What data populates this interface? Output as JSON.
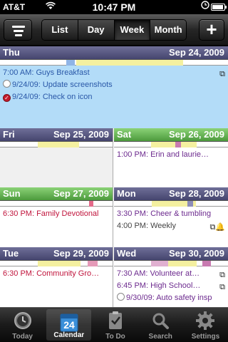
{
  "status": {
    "carrier": "AT&T",
    "time": "10:47 PM"
  },
  "nav": {
    "segments": [
      "List",
      "Day",
      "Week",
      "Month"
    ],
    "selected": "Week",
    "add": "+"
  },
  "days": [
    {
      "weekday": "Thu",
      "date": "Sep 24, 2009",
      "events": [
        {
          "text": "7:00 AM: Guys Breakfast",
          "color": "blue"
        },
        {
          "text": "9/24/09: Update screenshots",
          "color": "blue",
          "check": "empty"
        },
        {
          "text": "9/24/09: Check on icon",
          "color": "blue",
          "check": "done"
        }
      ]
    },
    {
      "weekday": "Fri",
      "date": "Sep 25, 2009",
      "events": []
    },
    {
      "weekday": "Sat",
      "date": "Sep 26, 2009",
      "events": [
        {
          "text": "1:00 PM: Erin and laurie…",
          "color": "purple"
        }
      ]
    },
    {
      "weekday": "Sun",
      "date": "Sep 27, 2009",
      "events": [
        {
          "text": "6:30 PM: Family Devotional",
          "color": "red"
        }
      ]
    },
    {
      "weekday": "Mon",
      "date": "Sep 28, 2009",
      "events": [
        {
          "text": "3:30 PM: Cheer & tumbling",
          "color": "purple"
        },
        {
          "text": "4:00 PM: Weekly",
          "color": "gray"
        }
      ]
    },
    {
      "weekday": "Tue",
      "date": "Sep 29, 2009",
      "events": [
        {
          "text": "6:30 PM: Community Gro…",
          "color": "red"
        }
      ]
    },
    {
      "weekday": "Wed",
      "date": "Sep 30, 2009",
      "events": [
        {
          "text": "7:30 AM: Volunteer at…",
          "color": "purple"
        },
        {
          "text": "6:45 PM: High School…",
          "color": "purple"
        },
        {
          "text": "9/30/09: Auto safety insp",
          "color": "purple",
          "check": "empty"
        }
      ]
    }
  ],
  "tabs": [
    {
      "label": "Today",
      "icon": "clock-icon"
    },
    {
      "label": "Calendar",
      "icon": "calendar-icon",
      "badge": "24",
      "active": true
    },
    {
      "label": "To Do",
      "icon": "checklist-icon"
    },
    {
      "label": "Search",
      "icon": "magnifier-icon"
    },
    {
      "label": "Settings",
      "icon": "gear-icon"
    }
  ]
}
